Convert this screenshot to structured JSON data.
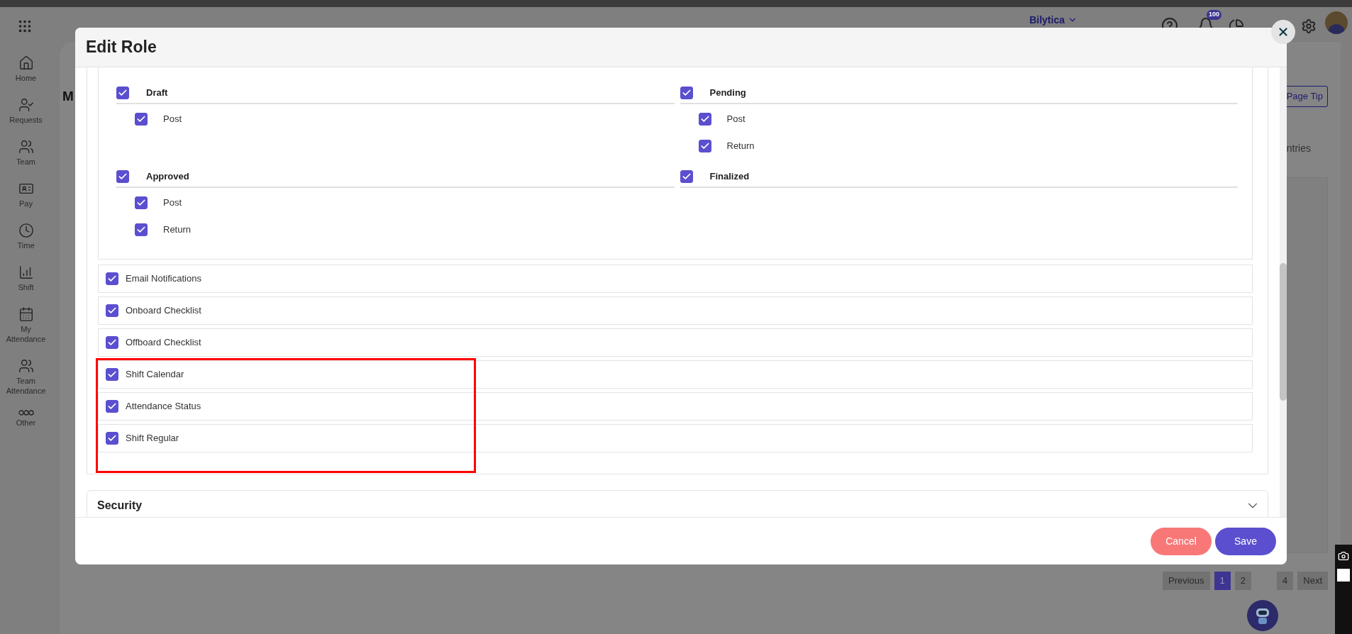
{
  "app_bar": {
    "brand": "Bilytica",
    "notification_count": "100"
  },
  "sidebar": {
    "items": [
      {
        "label": "Home",
        "kind": "home"
      },
      {
        "label": "Requests",
        "kind": "requests"
      },
      {
        "label": "Team",
        "kind": "team"
      },
      {
        "label": "Pay",
        "kind": "pay"
      },
      {
        "label": "Time",
        "kind": "time"
      },
      {
        "label": "Shift",
        "kind": "shift"
      },
      {
        "label": "My Attendance",
        "kind": "calendar"
      },
      {
        "label": "Team Attendance",
        "kind": "team"
      },
      {
        "label": "Other",
        "kind": "other"
      }
    ]
  },
  "background_page": {
    "title": "M",
    "page_tip": "Page Tip",
    "entries_text": "ntries",
    "pagination": [
      {
        "label": "Previous",
        "selected": false
      },
      {
        "label": "1",
        "selected": true
      },
      {
        "label": "2",
        "selected": false
      },
      {
        "label": "4",
        "selected": false
      },
      {
        "label": "Next",
        "selected": false
      }
    ]
  },
  "dialog": {
    "title": "Edit Role",
    "status_groups": [
      {
        "label": "Draft",
        "checked": true,
        "children": [
          {
            "label": "Post",
            "checked": true
          }
        ]
      },
      {
        "label": "Pending",
        "checked": true,
        "children": [
          {
            "label": "Post",
            "checked": true
          },
          {
            "label": "Return",
            "checked": true
          }
        ]
      },
      {
        "label": "Approved",
        "checked": true,
        "children": [
          {
            "label": "Post",
            "checked": true
          },
          {
            "label": "Return",
            "checked": true
          }
        ]
      },
      {
        "label": "Finalized",
        "checked": true
      }
    ],
    "permissions": [
      {
        "label": "Email Notifications",
        "checked": true,
        "highlighted": false
      },
      {
        "label": "Onboard Checklist",
        "checked": true,
        "highlighted": false
      },
      {
        "label": "Offboard Checklist",
        "checked": true,
        "highlighted": false
      },
      {
        "label": "Shift Calendar",
        "checked": true,
        "highlighted": true
      },
      {
        "label": "Attendance Status",
        "checked": true,
        "highlighted": true
      },
      {
        "label": "Shift Regular",
        "checked": true,
        "highlighted": true
      }
    ],
    "sections": [
      {
        "title": "Security",
        "expanded": false
      }
    ],
    "buttons": [
      {
        "label": "Cancel",
        "kind": "cancel"
      },
      {
        "label": "Save",
        "kind": "primary"
      }
    ]
  }
}
